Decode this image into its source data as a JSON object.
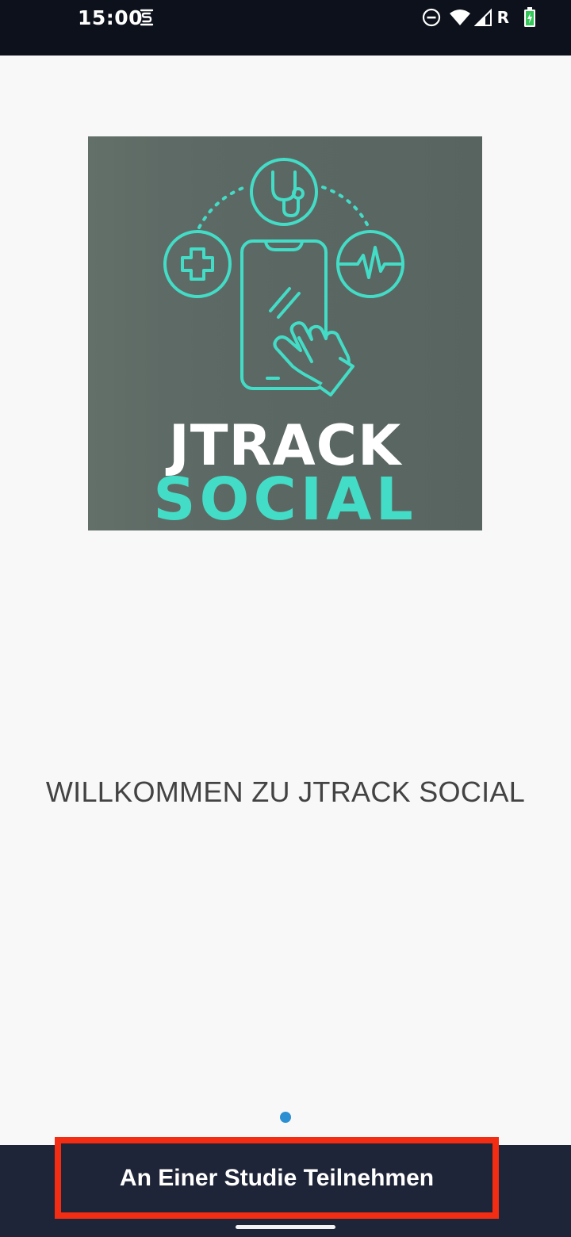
{
  "status_bar": {
    "time": "15:00",
    "app_icon": "s-notification-icon",
    "icons": [
      "do-not-disturb-icon",
      "wifi-icon",
      "cell-signal-icon",
      "battery-charging-icon"
    ],
    "roaming_label": "R"
  },
  "logo": {
    "line1": "JTRACK",
    "line2": "SOCIAL",
    "colors": {
      "background": "#5c6864",
      "accent": "#43dcc6",
      "text": "#ffffff"
    },
    "icons": [
      "stethoscope-icon",
      "medical-cross-icon",
      "heartbeat-icon",
      "smartphone-icon",
      "tapping-hand-icon"
    ]
  },
  "welcome": {
    "title": "WILLKOMMEN ZU JTRACK SOCIAL"
  },
  "pager": {
    "current_page": 1,
    "total_pages": 1,
    "active_color": "#2c8fd2"
  },
  "actions": {
    "join_study_label": "An Einer Studie Teilnehmen",
    "highlight_color": "#f32d14",
    "bar_color": "#1f2538"
  }
}
